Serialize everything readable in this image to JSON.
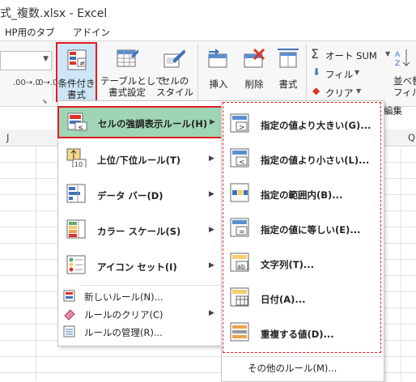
{
  "window": {
    "title": "式_複数.xlsx - Excel"
  },
  "tabs": [
    {
      "label": "HP用のタブ"
    },
    {
      "label": "アドイン"
    }
  ],
  "ribbon": {
    "conditional_format": {
      "line1": "条件付き",
      "line2": "書式"
    },
    "format_as_table": {
      "line1": "テーブルとして",
      "line2": "書式設定"
    },
    "cell_styles": {
      "line1": "セルの",
      "line2": "スタイル"
    },
    "insert": {
      "label": "挿入"
    },
    "delete": {
      "label": "削除"
    },
    "format": {
      "label": "書式"
    },
    "autosum": {
      "label": "オート SUM"
    },
    "fill": {
      "label": "フィル"
    },
    "clear": {
      "label": "クリア"
    },
    "sort": {
      "line1": "並べ替",
      "line2": "フィル"
    },
    "editing_group": {
      "label": "編集"
    },
    "decrease_decimal": {
      "label": ".00→.0"
    },
    "increase_decimal": {
      "label": ".0→.00"
    }
  },
  "columns": [
    {
      "label": "J"
    },
    {
      "label": "Q"
    }
  ],
  "menu": {
    "items": [
      {
        "label": "セルの強調表示ルール(H)",
        "icon": "highlight-cells-icon"
      },
      {
        "label": "上位/下位ルール(T)",
        "icon": "top-bottom-icon"
      },
      {
        "label": "データ バー(D)",
        "icon": "data-bars-icon"
      },
      {
        "label": "カラー スケール(S)",
        "icon": "color-scales-icon"
      },
      {
        "label": "アイコン セット(I)",
        "icon": "icon-sets-icon"
      }
    ],
    "small_items": [
      {
        "label": "新しいルール(N)..."
      },
      {
        "label": "ルールのクリア(C)"
      },
      {
        "label": "ルールの管理(R)..."
      }
    ]
  },
  "submenu": {
    "items": [
      {
        "label": "指定の値より大きい(G)..."
      },
      {
        "label": "指定の値より小さい(L)..."
      },
      {
        "label": "指定の範囲内(B)..."
      },
      {
        "label": "指定の値に等しい(E)..."
      },
      {
        "label": "文字列(T)..."
      },
      {
        "label": "日付(A)..."
      },
      {
        "label": "重複する値(D)..."
      }
    ],
    "more": {
      "label": "その他のルール(M)..."
    }
  },
  "colors": {
    "accent_red": "#e51c23",
    "hover_green": "#9fd5b5",
    "hover_blue": "#cde6f7"
  }
}
